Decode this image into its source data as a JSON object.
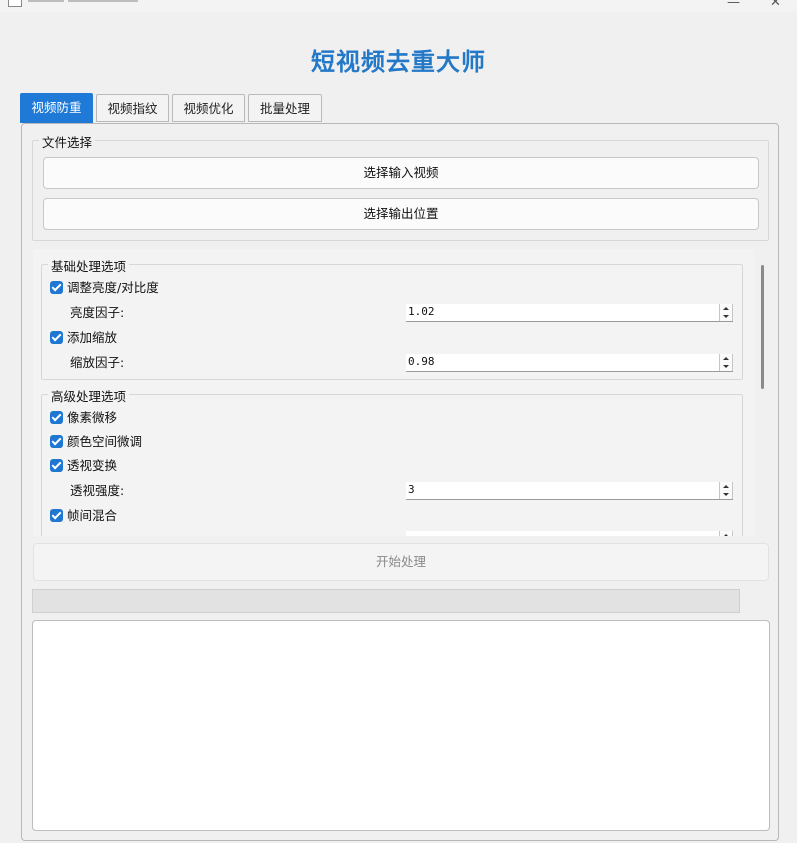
{
  "window": {
    "controls": {
      "minimize": "—",
      "close": "✕"
    }
  },
  "app_title": "短视频去重大师",
  "tabs": [
    {
      "label": "视频防重",
      "active": true
    },
    {
      "label": "视频指纹",
      "active": false
    },
    {
      "label": "视频优化",
      "active": false
    },
    {
      "label": "批量处理",
      "active": false
    }
  ],
  "file_select": {
    "title": "文件选择",
    "input_button": "选择输入视频",
    "output_button": "选择输出位置"
  },
  "basic": {
    "title": "基础处理选项",
    "brightness_checkbox": {
      "label": "调整亮度/对比度",
      "checked": true
    },
    "brightness_factor": {
      "label": "亮度因子:",
      "value": "1.02"
    },
    "zoom_checkbox": {
      "label": "添加缩放",
      "checked": true
    },
    "zoom_factor": {
      "label": "缩放因子:",
      "value": "0.98"
    }
  },
  "advanced": {
    "title": "高级处理选项",
    "pixel_shift": {
      "label": "像素微移",
      "checked": true
    },
    "color_space": {
      "label": "颜色空间微调",
      "checked": true
    },
    "perspective": {
      "label": "透视变换",
      "checked": true
    },
    "perspective_strength": {
      "label": "透视强度:",
      "value": "3"
    },
    "frame_blend": {
      "label": "帧间混合",
      "checked": true
    }
  },
  "start_button": "开始处理",
  "progress": {
    "value": 0
  },
  "colors": {
    "accent": "#1e7ad6",
    "title": "#2378c8"
  }
}
